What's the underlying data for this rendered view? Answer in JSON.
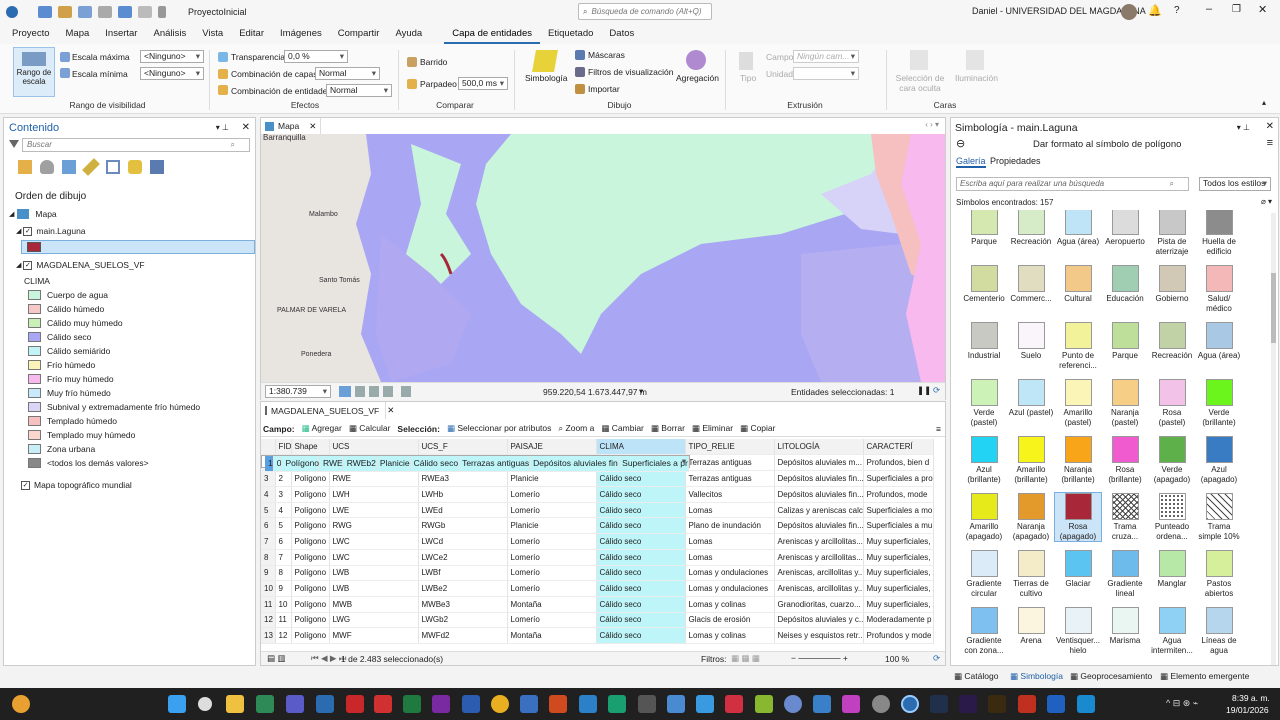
{
  "titlebar": {
    "project": "ProyectoInicial",
    "search_placeholder": "Búsqueda de comando (Alt+Q)",
    "user": "Daniel - UNIVERSIDAD DEL MAGDALENA"
  },
  "menu_tabs": [
    "Proyecto",
    "Mapa",
    "Insertar",
    "Análisis",
    "Vista",
    "Editar",
    "Imágenes",
    "Compartir",
    "Ayuda",
    "Capa de entidades",
    "Etiquetado",
    "Datos"
  ],
  "ribbon": {
    "rango_escala": "Rango de escala",
    "escala_maxima": "Escala máxima",
    "escala_minima": "Escala mínima",
    "ninguno": "<Ninguno>",
    "rango_visibilidad": "Rango de visibilidad",
    "transparencia": "Transparencia",
    "transparencia_val": "0,0 %",
    "combinacion_capas": "Combinación de capas",
    "combinacion_entidades": "Combinación de entidades",
    "normal": "Normal",
    "efectos": "Efectos",
    "barrido": "Barrido",
    "parpadeo": "Parpadeo",
    "parpadeo_val": "500,0",
    "ms": "ms",
    "comparar": "Comparar",
    "simbologia": "Simbología",
    "mascaras": "Máscaras",
    "filtros_visualizacion": "Filtros de visualización",
    "importar": "Importar",
    "agregacion": "Agregación",
    "dibujo": "Dibujo",
    "tipo": "Tipo",
    "campo": "Campo",
    "campo_val": "Ningún cam...",
    "unidad": "Unidad",
    "extrusion": "Extrusión",
    "seleccion_cara_oculta": "Selección de cara oculta",
    "iluminacion": "Iluminación",
    "caras": "Caras"
  },
  "contents": {
    "title": "Contenido",
    "search_placeholder": "Buscar",
    "orden_dibujo": "Orden de dibujo",
    "mapa": "Mapa",
    "layer1": "main.Laguna",
    "layer2": "MAGDALENA_SUELOS_VF",
    "clima": "CLIMA",
    "legend": [
      {
        "label": "Cuerpo de agua",
        "color": "#c8f5dc"
      },
      {
        "label": "Cálido húmedo",
        "color": "#f6c8c8"
      },
      {
        "label": "Cálido muy húmedo",
        "color": "#c9f0b6"
      },
      {
        "label": "Cálido seco",
        "color": "#a9a6f4"
      },
      {
        "label": "Cálido semiárido",
        "color": "#c2f3f5"
      },
      {
        "label": "Frío húmedo",
        "color": "#faf4b8"
      },
      {
        "label": "Frío muy húmedo",
        "color": "#f7b9ee"
      },
      {
        "label": "Muy frío húmedo",
        "color": "#c7e9fa"
      },
      {
        "label": "Subnival y extremadamente frío húmedo",
        "color": "#dcd4f7"
      },
      {
        "label": "Templado húmedo",
        "color": "#f7c0c0"
      },
      {
        "label": "Templado muy húmedo",
        "color": "#fbd6cc"
      },
      {
        "label": "Zona urbana",
        "color": "#c8eef7"
      },
      {
        "label": "<todos los demás valores>",
        "color": "#888888"
      }
    ],
    "topo": "Mapa topográfico mundial"
  },
  "map": {
    "tab": "Mapa",
    "labels": [
      "Barranquilla",
      "Malambo",
      "Santo Tomás",
      "PALMAR DE VARELA",
      "Ponedera"
    ],
    "scale": "1:380.739",
    "coords": "959.220,54 1.673.447,97 m",
    "selected": "Entidades seleccionadas: 1"
  },
  "table": {
    "tab": "MAGDALENA_SUELOS_VF",
    "toolbar": {
      "campo": "Campo:",
      "agregar": "Agregar",
      "calcular": "Calcular",
      "seleccion": "Selección:",
      "sel_atributos": "Seleccionar por atributos",
      "zoom": "Zoom a",
      "cambiar": "Cambiar",
      "borrar": "Borrar",
      "eliminar": "Eliminar",
      "copiar": "Copiar"
    },
    "columns": [
      "FID",
      "Shape",
      "UCS",
      "UCS_F",
      "PAISAJE",
      "CLIMA",
      "TIPO_RELIE",
      "LITOLOGÍA",
      "CARACTERÍ"
    ],
    "rows": [
      [
        "1",
        "0",
        "Polígono",
        "RWE",
        "RWEb2",
        "Planicie",
        "Cálido seco",
        "Terrazas antiguas",
        "Depósitos aluviales fin...",
        "Superficiales a pro"
      ],
      [
        "2",
        "1",
        "Polígono",
        "RWF",
        "RWFb",
        "Planicie",
        "Cálido seco",
        "Terrazas antiguas",
        "Depósitos aluviales m...",
        "Profundos, bien d"
      ],
      [
        "3",
        "2",
        "Polígono",
        "RWE",
        "RWEa3",
        "Planicie",
        "Cálido seco",
        "Terrazas antiguas",
        "Depósitos aluviales fin...",
        "Superficiales a pro"
      ],
      [
        "4",
        "3",
        "Polígono",
        "LWH",
        "LWHb",
        "Lomerío",
        "Cálido seco",
        "Vallecitos",
        "Depósitos aluviales fin...",
        "Profundos, mode"
      ],
      [
        "5",
        "4",
        "Polígono",
        "LWE",
        "LWEd",
        "Lomerío",
        "Cálido seco",
        "Lomas",
        "Calizas y areniscas calc...",
        "Superficiales a mo"
      ],
      [
        "6",
        "5",
        "Polígono",
        "RWG",
        "RWGb",
        "Planicie",
        "Cálido seco",
        "Plano de inundación",
        "Depósitos aluviales fin...",
        "Superficiales a mu"
      ],
      [
        "7",
        "6",
        "Polígono",
        "LWC",
        "LWCd",
        "Lomerío",
        "Cálido seco",
        "Lomas",
        "Areniscas y arcillolitas...",
        "Muy superficiales,"
      ],
      [
        "8",
        "7",
        "Polígono",
        "LWC",
        "LWCe2",
        "Lomerío",
        "Cálido seco",
        "Lomas",
        "Areniscas y arcillolitas...",
        "Muy superficiales,"
      ],
      [
        "9",
        "8",
        "Polígono",
        "LWB",
        "LWBf",
        "Lomerío",
        "Cálido seco",
        "Lomas y ondulaciones",
        "Areniscas, arcillolitas y...",
        "Muy superficiales,"
      ],
      [
        "10",
        "9",
        "Polígono",
        "LWB",
        "LWBe2",
        "Lomerío",
        "Cálido seco",
        "Lomas y ondulaciones",
        "Areniscas, arcillolitas y...",
        "Muy superficiales,"
      ],
      [
        "11",
        "10",
        "Polígono",
        "MWB",
        "MWBe3",
        "Montaña",
        "Cálido seco",
        "Lomas y colinas",
        "Granodioritas, cuarzo...",
        "Muy superficiales,"
      ],
      [
        "12",
        "11",
        "Polígono",
        "LWG",
        "LWGb2",
        "Lomerío",
        "Cálido seco",
        "Glacis de erosión",
        "Depósitos aluviales y c...",
        "Moderadamente p"
      ],
      [
        "13",
        "12",
        "Polígono",
        "MWF",
        "MWFd2",
        "Montaña",
        "Cálido seco",
        "Lomas y colinas",
        "Neises y esquistos retr...",
        "Profundos y mode"
      ]
    ],
    "footer": "1 de 2.483 seleccionado(s)",
    "filtros": "Filtros:",
    "zoom": "100 %"
  },
  "symbology": {
    "title": "Simbología - main.Laguna",
    "subtitle": "Dar formato al símbolo de polígono",
    "tab_galeria": "Galería",
    "tab_propiedades": "Propiedades",
    "search_placeholder": "Escriba aquí para realizar una búsqueda",
    "estilos": "Todos los estilos",
    "found": "Símbolos encontrados: 157",
    "rows": [
      [
        [
          "Parque",
          "#d5e8b0"
        ],
        [
          "Recreación",
          "#d6ecc9"
        ],
        [
          "Agua (área)",
          "#bfe3f7"
        ],
        [
          "Aeropuerto",
          "#dcdcdc"
        ],
        [
          "Pista de aterrizaje",
          "#c8c8c8"
        ],
        [
          "Huella de edificio",
          "#8c8c8c"
        ]
      ],
      [
        [
          "Cementerio",
          "#d3dca0"
        ],
        [
          "Commerc...",
          "#e0ddc0"
        ],
        [
          "Cultural",
          "#f3c98a"
        ],
        [
          "Educación",
          "#9fceb2"
        ],
        [
          "Gobierno",
          "#d2c8b6"
        ],
        [
          "Salud/ médico",
          "#f5b8b8"
        ]
      ],
      [
        [
          "Industrial",
          "#c9c9c4"
        ],
        [
          "Suelo",
          "#faf5fb"
        ],
        [
          "Punto de referenci...",
          "#f1f29a"
        ],
        [
          "Parque",
          "#bedf99"
        ],
        [
          "Recreación",
          "#c1d3a6"
        ],
        [
          "Agua (área)",
          "#a8c8e3"
        ]
      ],
      [
        [
          "Verde (pastel)",
          "#cdf2b8"
        ],
        [
          "Azul (pastel)",
          "#bfe6f7"
        ],
        [
          "Amarillo (pastel)",
          "#fbf6b8"
        ],
        [
          "Naranja (pastel)",
          "#f6ce86"
        ],
        [
          "Rosa (pastel)",
          "#f2c2e8"
        ],
        [
          "Verde (brillante)",
          "#6cf51c"
        ]
      ],
      [
        [
          "Azul (brillante)",
          "#22d3f3"
        ],
        [
          "Amarillo (brillante)",
          "#f7f41c"
        ],
        [
          "Naranja (brillante)",
          "#f9a51a"
        ],
        [
          "Rosa (brillante)",
          "#f05cd0"
        ],
        [
          "Verde (apagado)",
          "#5db04a"
        ],
        [
          "Azul (apagado)",
          "#3a7cc4"
        ]
      ],
      [
        [
          "Amarillo (apagado)",
          "#e6ea1a"
        ],
        [
          "Naranja (apagado)",
          "#e49a2a"
        ],
        [
          "Rosa (apagado)",
          "#a8283a"
        ],
        [
          "Trama cruza...",
          "#ffffff"
        ],
        [
          "Punteado ordena...",
          "#ffffff"
        ],
        [
          "Trama simple 10%",
          "#ffffff"
        ]
      ],
      [
        [
          "Gradiente circular",
          "#dcebf8"
        ],
        [
          "Tierras de cultivo",
          "#f4ecc8"
        ],
        [
          "Glaciar",
          "#5cc4f0"
        ],
        [
          "Gradiente lineal",
          "#6cbbea"
        ],
        [
          "Manglar",
          "#b8e8a8"
        ],
        [
          "Pastos abiertos",
          "#d6ef9a"
        ]
      ],
      [
        [
          "Gradiente con zona...",
          "#7ec1f0"
        ],
        [
          "Arena",
          "#fbf5e0"
        ],
        [
          "Ventisquer... hielo",
          "#e8f2f7"
        ],
        [
          "Marisma",
          "#eaf6f2"
        ],
        [
          "Agua intermiten...",
          "#8fd0f5"
        ],
        [
          "Líneas de agua",
          "#b6d6ee"
        ]
      ]
    ],
    "bottom_tabs": [
      "Catálogo",
      "Simbología",
      "Geoprocesamiento",
      "Elemento emergente"
    ]
  },
  "taskbar": {
    "time": "8:39 a. m.",
    "date": "19/01/2026"
  }
}
